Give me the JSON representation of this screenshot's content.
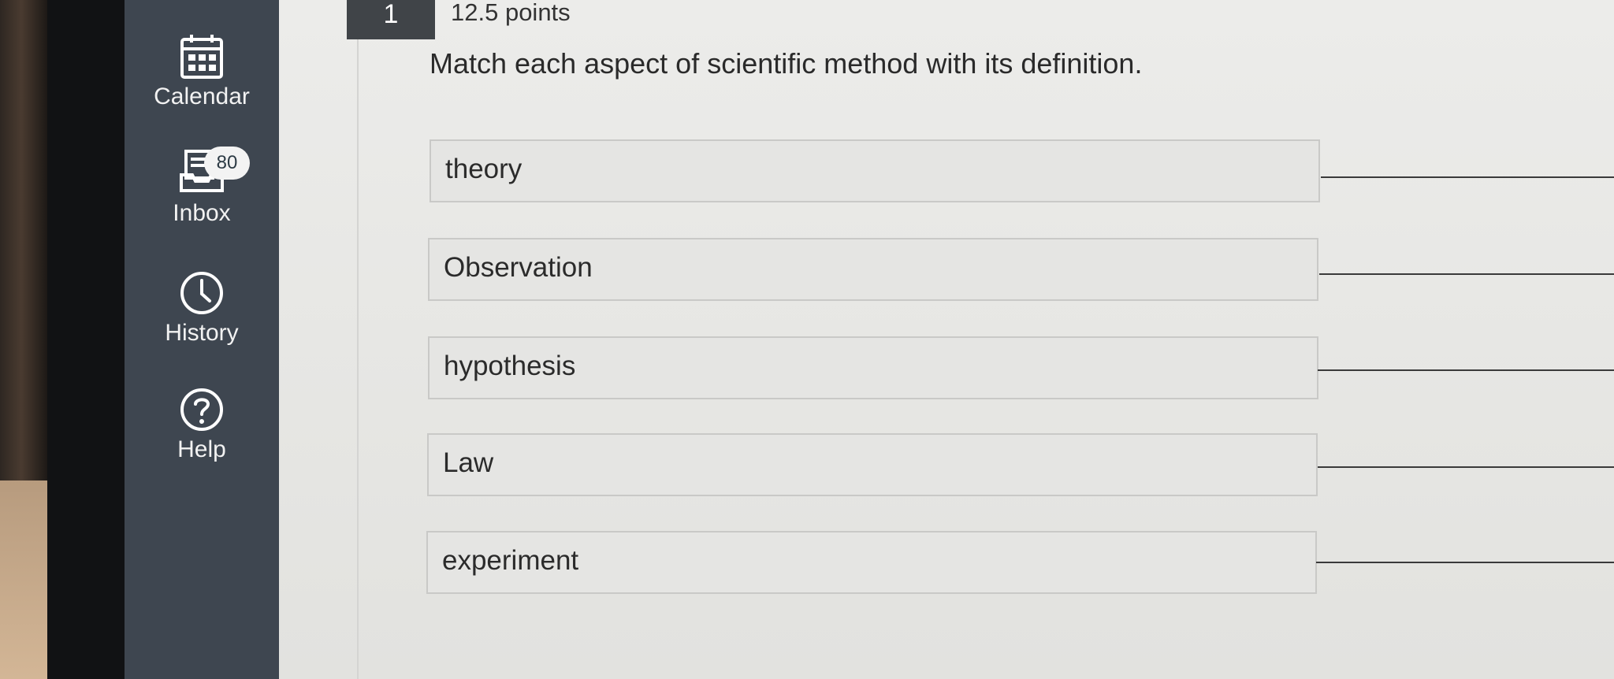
{
  "sidebar": {
    "items": [
      {
        "label": "Calendar",
        "icon": "calendar-icon"
      },
      {
        "label": "Inbox",
        "icon": "inbox-icon",
        "badge": "80"
      },
      {
        "label": "History",
        "icon": "clock-icon"
      },
      {
        "label": "Help",
        "icon": "question-icon"
      }
    ]
  },
  "question": {
    "number": "1",
    "points": "12.5 points",
    "prompt": "Match each aspect of scientific method with its definition.",
    "terms": [
      "theory",
      "Observation",
      "hypothesis",
      "Law",
      "experiment"
    ]
  },
  "colors": {
    "sidebar": "#3e4650",
    "question_number_bg": "#404448",
    "content_bg": "#ececea"
  }
}
